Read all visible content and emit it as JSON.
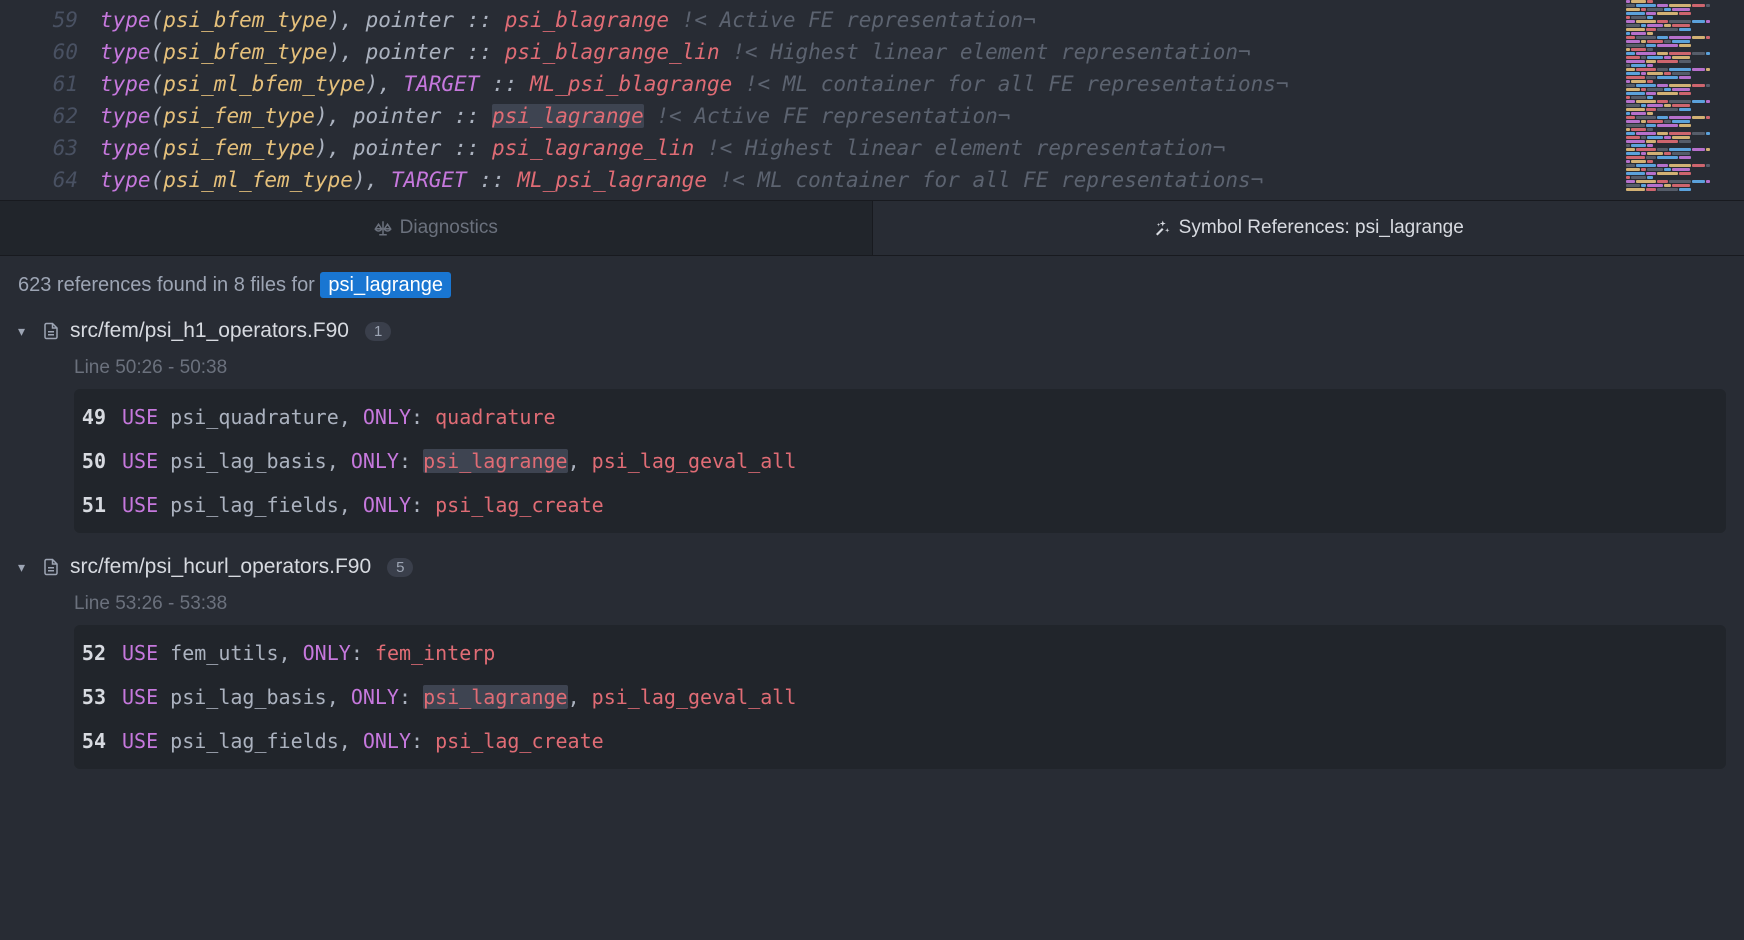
{
  "editor": {
    "lines": [
      {
        "num": 59,
        "type_arg": "psi_bfem_type",
        "attr": "pointer",
        "var": "psi_blagrange",
        "comment": "!< Active FE representation¬",
        "target": false
      },
      {
        "num": 60,
        "type_arg": "psi_bfem_type",
        "attr": "pointer",
        "var": "psi_blagrange_lin",
        "comment": "!< Highest linear element representation¬",
        "target": false
      },
      {
        "num": 61,
        "type_arg": "psi_ml_bfem_type",
        "attr": "TARGET",
        "var": "ML_psi_blagrange",
        "comment": "!< ML container for all FE representations¬",
        "target": true
      },
      {
        "num": 62,
        "type_arg": "psi_fem_type",
        "attr": "pointer",
        "var": "psi_lagrange",
        "comment": "!< Active FE representation¬",
        "target": false,
        "highlighted": true
      },
      {
        "num": 63,
        "type_arg": "psi_fem_type",
        "attr": "pointer",
        "var": "psi_lagrange_lin",
        "comment": "!< Highest linear element representation¬",
        "target": false
      },
      {
        "num": 64,
        "type_arg": "psi_ml_fem_type",
        "attr": "TARGET",
        "var": "ML_psi_lagrange",
        "comment": "!< ML container for all FE representations¬",
        "target": true
      }
    ]
  },
  "tabs": {
    "diagnostics": "Diagnostics",
    "references_prefix": "Symbol References:",
    "references_symbol": "psi_lagrange"
  },
  "references": {
    "count": 623,
    "file_count": 8,
    "summary_prefix": "623 references found in 8 files for ",
    "symbol": "psi_lagrange",
    "files": [
      {
        "path": "src/fem/psi_h1_operators.F90",
        "match_count": 1,
        "range": "Line 50:26 - 50:38",
        "snippet": [
          {
            "num": 49,
            "module": "psi_quadrature",
            "imports": [
              "quadrature"
            ],
            "match": -1
          },
          {
            "num": 50,
            "module": "psi_lag_basis",
            "imports": [
              "psi_lagrange",
              "psi_lag_geval_all"
            ],
            "match": 0
          },
          {
            "num": 51,
            "module": "psi_lag_fields",
            "imports": [
              "psi_lag_create"
            ],
            "match": -1
          }
        ]
      },
      {
        "path": "src/fem/psi_hcurl_operators.F90",
        "match_count": 5,
        "range": "Line 53:26 - 53:38",
        "snippet": [
          {
            "num": 52,
            "module": "fem_utils",
            "imports": [
              "fem_interp"
            ],
            "match": -1
          },
          {
            "num": 53,
            "module": "psi_lag_basis",
            "imports": [
              "psi_lagrange",
              "psi_lag_geval_all"
            ],
            "match": 0
          },
          {
            "num": 54,
            "module": "psi_lag_fields",
            "imports": [
              "psi_lag_create"
            ],
            "match": -1
          }
        ]
      }
    ]
  }
}
